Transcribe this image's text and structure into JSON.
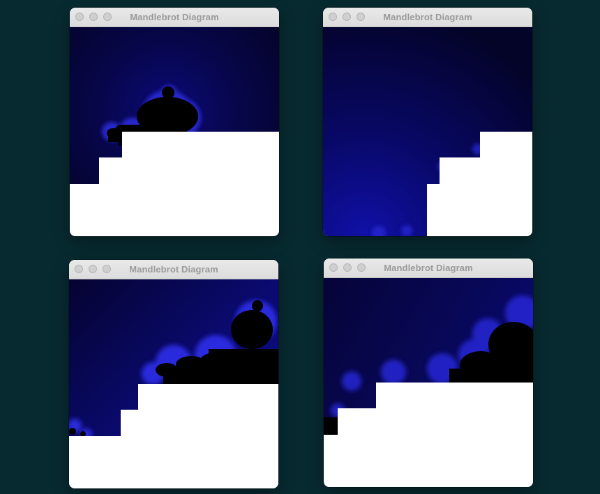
{
  "windows": [
    {
      "title": "Mandlebrot Diagram"
    },
    {
      "title": "Mandlebrot Diagram"
    },
    {
      "title": "Mandlebrot Diagram"
    },
    {
      "title": "Mandlebrot Diagram"
    }
  ],
  "colors": {
    "desktop": "#072a30",
    "fractal_dark": "#050326",
    "fractal_blue": "#0a0a8a",
    "fractal_bright": "#3a3aff",
    "set_interior": "#000000",
    "unrendered": "#ffffff"
  }
}
